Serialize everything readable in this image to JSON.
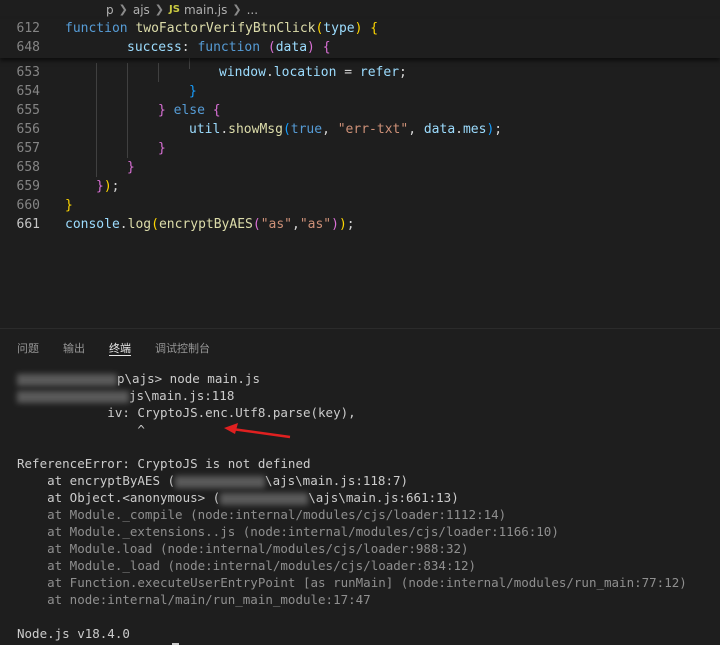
{
  "breadcrumb": {
    "parent": "p",
    "folder": "ajs",
    "js_badge": "JS",
    "file": "main.js",
    "more": "..."
  },
  "editor": {
    "sticky": [
      {
        "num": "612",
        "code": [
          {
            "c": "kw",
            "t": "function "
          },
          {
            "c": "fn",
            "t": "twoFactorVerifyBtnClick"
          },
          {
            "c": "b1",
            "t": "("
          },
          {
            "c": "var",
            "t": "type"
          },
          {
            "c": "b1",
            "t": ")"
          },
          {
            "c": "pl",
            "t": " "
          },
          {
            "c": "b1",
            "t": "{"
          }
        ],
        "indent": 0
      },
      {
        "num": "648",
        "code": [
          {
            "c": "var",
            "t": "success"
          },
          {
            "c": "pl",
            "t": ": "
          },
          {
            "c": "kw",
            "t": "function "
          },
          {
            "c": "b2",
            "t": "("
          },
          {
            "c": "var",
            "t": "data"
          },
          {
            "c": "b2",
            "t": ")"
          },
          {
            "c": "pl",
            "t": " "
          },
          {
            "c": "b2",
            "t": "{"
          }
        ],
        "indent": 62
      }
    ],
    "lines": [
      {
        "num": "653",
        "code": [
          {
            "c": "var",
            "t": "window"
          },
          {
            "c": "pl",
            "t": "."
          },
          {
            "c": "var",
            "t": "location"
          },
          {
            "c": "pl",
            "t": " = "
          },
          {
            "c": "var",
            "t": "refer"
          },
          {
            "c": "pl",
            "t": ";"
          }
        ],
        "indent": 154
      },
      {
        "num": "654",
        "code": [
          {
            "c": "b3",
            "t": "}"
          }
        ],
        "indent": 124
      },
      {
        "num": "655",
        "code": [
          {
            "c": "b2",
            "t": "}"
          },
          {
            "c": "pl",
            "t": " "
          },
          {
            "c": "kw",
            "t": "else"
          },
          {
            "c": "pl",
            "t": " "
          },
          {
            "c": "b2",
            "t": "{"
          }
        ],
        "indent": 93
      },
      {
        "num": "656",
        "code": [
          {
            "c": "var",
            "t": "util"
          },
          {
            "c": "pl",
            "t": "."
          },
          {
            "c": "fn",
            "t": "showMsg"
          },
          {
            "c": "b3",
            "t": "("
          },
          {
            "c": "kw",
            "t": "true"
          },
          {
            "c": "pl",
            "t": ", "
          },
          {
            "c": "str",
            "t": "\"err-txt\""
          },
          {
            "c": "pl",
            "t": ", "
          },
          {
            "c": "var",
            "t": "data"
          },
          {
            "c": "pl",
            "t": "."
          },
          {
            "c": "var",
            "t": "mes"
          },
          {
            "c": "b3",
            "t": ")"
          },
          {
            "c": "pl",
            "t": ";"
          }
        ],
        "indent": 124
      },
      {
        "num": "657",
        "code": [
          {
            "c": "b2",
            "t": "}"
          }
        ],
        "indent": 93
      },
      {
        "num": "658",
        "code": [
          {
            "c": "b2",
            "t": "}"
          }
        ],
        "indent": 62
      },
      {
        "num": "659",
        "code": [
          {
            "c": "b2",
            "t": "}"
          },
          {
            "c": "b1",
            "t": ")"
          },
          {
            "c": "pl",
            "t": ";"
          }
        ],
        "indent": 31
      },
      {
        "num": "660",
        "code": [
          {
            "c": "b1",
            "t": "}"
          }
        ],
        "indent": 0
      },
      {
        "num": "661",
        "active": true,
        "code": [
          {
            "c": "var",
            "t": "console"
          },
          {
            "c": "pl",
            "t": "."
          },
          {
            "c": "fn",
            "t": "log"
          },
          {
            "c": "b1",
            "t": "("
          },
          {
            "c": "fn",
            "t": "encryptByAES"
          },
          {
            "c": "b2",
            "t": "("
          },
          {
            "c": "str",
            "t": "\"as\""
          },
          {
            "c": "pl",
            "t": ","
          },
          {
            "c": "str",
            "t": "\"as\""
          },
          {
            "c": "b2",
            "t": ")"
          },
          {
            "c": "b1",
            "t": ")"
          },
          {
            "c": "pl",
            "t": ";"
          }
        ],
        "indent": 0
      }
    ]
  },
  "panel": {
    "tabs": [
      {
        "label": "问题",
        "active": false
      },
      {
        "label": "输出",
        "active": false
      },
      {
        "label": "终端",
        "active": true
      },
      {
        "label": "调试控制台",
        "active": false
      }
    ]
  },
  "terminal": {
    "lines": [
      {
        "parts": [
          {
            "blur": 100
          },
          {
            "t": "p\\ajs> node main.js"
          }
        ]
      },
      {
        "parts": [
          {
            "blur": 112
          },
          {
            "t": "js\\main.js:118"
          }
        ]
      },
      {
        "parts": [
          {
            "t": "            iv: CryptoJS.enc.Utf8.parse(key),"
          }
        ]
      },
      {
        "parts": [
          {
            "t": "                ^"
          }
        ]
      },
      {
        "parts": [
          {
            "t": ""
          }
        ]
      },
      {
        "parts": [
          {
            "t": "ReferenceError: CryptoJS is not defined"
          }
        ]
      },
      {
        "parts": [
          {
            "t": "    at encryptByAES ("
          },
          {
            "blur": 90
          },
          {
            "t": "\\ajs\\main.js:118:7)"
          }
        ]
      },
      {
        "parts": [
          {
            "t": "    at Object.<anonymous> ("
          },
          {
            "blur": 88
          },
          {
            "t": "\\ajs\\main.js:661:13)"
          }
        ]
      },
      {
        "dim": true,
        "parts": [
          {
            "t": "    at Module._compile (node:internal/modules/cjs/loader:1112:14)"
          }
        ]
      },
      {
        "dim": true,
        "parts": [
          {
            "t": "    at Module._extensions..js (node:internal/modules/cjs/loader:1166:10)"
          }
        ]
      },
      {
        "dim": true,
        "parts": [
          {
            "t": "    at Module.load (node:internal/modules/cjs/loader:988:32)"
          }
        ]
      },
      {
        "dim": true,
        "parts": [
          {
            "t": "    at Module._load (node:internal/modules/cjs/loader:834:12)"
          }
        ]
      },
      {
        "dim": true,
        "parts": [
          {
            "t": "    at Function.executeUserEntryPoint [as runMain] (node:internal/modules/run_main:77:12)"
          }
        ]
      },
      {
        "dim": true,
        "parts": [
          {
            "t": "    at node:internal/main/run_main_module:17:47"
          }
        ]
      },
      {
        "parts": [
          {
            "t": ""
          }
        ]
      },
      {
        "parts": [
          {
            "t": "Node.js v18.4.0"
          }
        ]
      }
    ]
  },
  "colors": {
    "background": "#1e1e1e",
    "keyword": "#569cd6",
    "function": "#dcdcaa",
    "variable": "#9cdcfe",
    "string": "#ce9178",
    "annotation_arrow": "#e02020"
  }
}
